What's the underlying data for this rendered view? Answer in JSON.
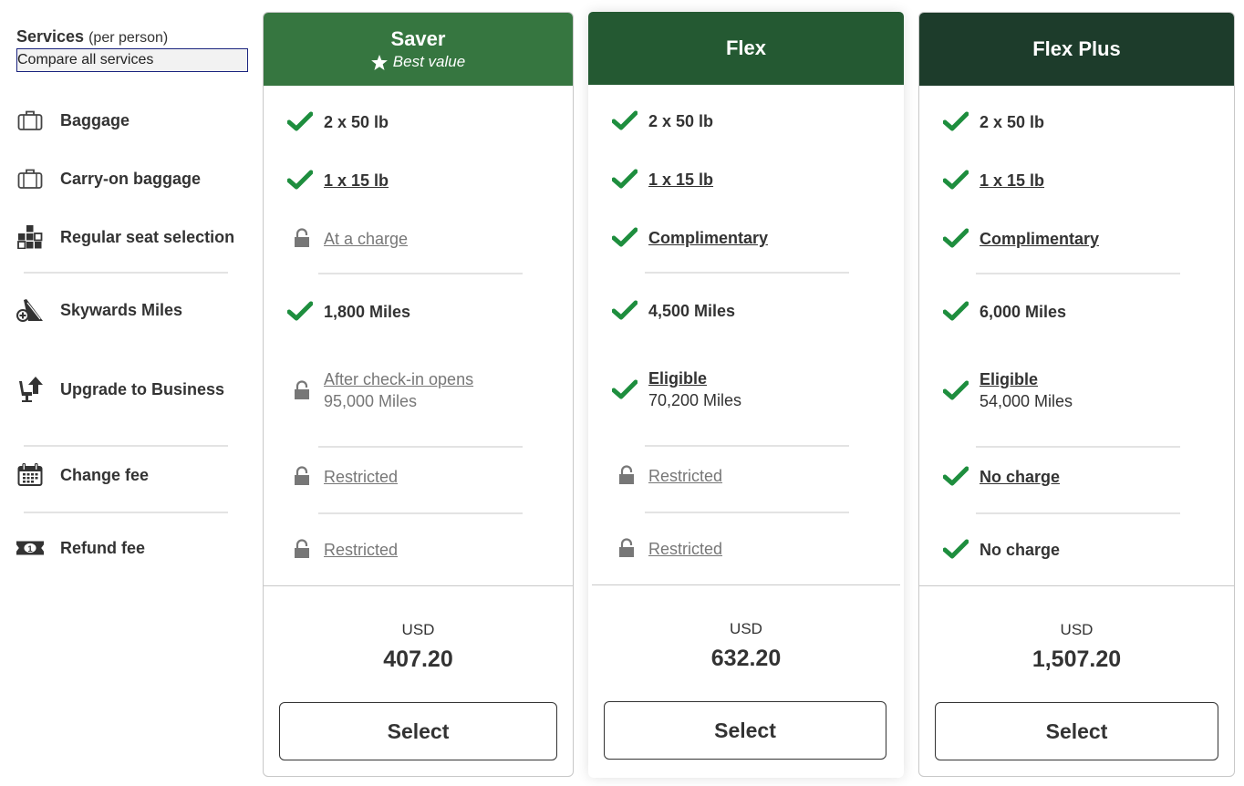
{
  "services": {
    "title": "Services",
    "subtitle": "(per person)",
    "compare_link": "Compare all services"
  },
  "rows": [
    {
      "label": "Baggage",
      "icon": "suitcase-icon"
    },
    {
      "label": "Carry-on baggage",
      "icon": "suitcase-icon"
    },
    {
      "label": "Regular seat selection",
      "icon": "seat-grid-icon"
    },
    {
      "label": "Skywards Miles",
      "icon": "skywards-miles-icon"
    },
    {
      "label": "Upgrade to Business",
      "icon": "upgrade-seat-icon"
    },
    {
      "label": "Change fee",
      "icon": "calendar-icon"
    },
    {
      "label": "Refund fee",
      "icon": "money-icon"
    }
  ],
  "fares": [
    {
      "name": "Saver",
      "badge": "Best value",
      "header_color": "#367640",
      "cells": [
        {
          "status": "included",
          "text": "2 x 50 lb",
          "link": false
        },
        {
          "status": "included",
          "text": "1 x 15 lb",
          "link": true
        },
        {
          "status": "locked",
          "text": "At a charge",
          "link": true
        },
        {
          "status": "included",
          "text": "1,800 Miles",
          "link": false
        },
        {
          "status": "locked",
          "text": "After check-in opens",
          "link": true,
          "second": "95,000 Miles"
        },
        {
          "status": "locked",
          "text": "Restricted",
          "link": true
        },
        {
          "status": "locked",
          "text": "Restricted",
          "link": true
        }
      ],
      "currency": "USD",
      "price": "407.20",
      "button": "Select"
    },
    {
      "name": "Flex",
      "badge": "",
      "header_color": "#245932",
      "cells": [
        {
          "status": "included",
          "text": "2 x 50 lb",
          "link": false
        },
        {
          "status": "included",
          "text": "1 x 15 lb",
          "link": true
        },
        {
          "status": "included",
          "text": "Complimentary",
          "link": true
        },
        {
          "status": "included",
          "text": "4,500 Miles",
          "link": false
        },
        {
          "status": "included",
          "text": "Eligible",
          "link": true,
          "second": "70,200 Miles"
        },
        {
          "status": "locked",
          "text": "Restricted",
          "link": true
        },
        {
          "status": "locked",
          "text": "Restricted",
          "link": true
        }
      ],
      "currency": "USD",
      "price": "632.20",
      "button": "Select"
    },
    {
      "name": "Flex Plus",
      "badge": "",
      "header_color": "#1d3c2b",
      "cells": [
        {
          "status": "included",
          "text": "2 x 50 lb",
          "link": false
        },
        {
          "status": "included",
          "text": "1 x 15 lb",
          "link": true
        },
        {
          "status": "included",
          "text": "Complimentary",
          "link": true
        },
        {
          "status": "included",
          "text": "6,000 Miles",
          "link": false
        },
        {
          "status": "included",
          "text": "Eligible",
          "link": true,
          "second": "54,000 Miles"
        },
        {
          "status": "included",
          "text": "No charge",
          "link": true
        },
        {
          "status": "included",
          "text": "No charge",
          "link": false
        }
      ],
      "currency": "USD",
      "price": "1,507.20",
      "button": "Select"
    }
  ],
  "colors": {
    "check": "#1e8e3e",
    "lock": "#777777",
    "text": "#333333"
  }
}
